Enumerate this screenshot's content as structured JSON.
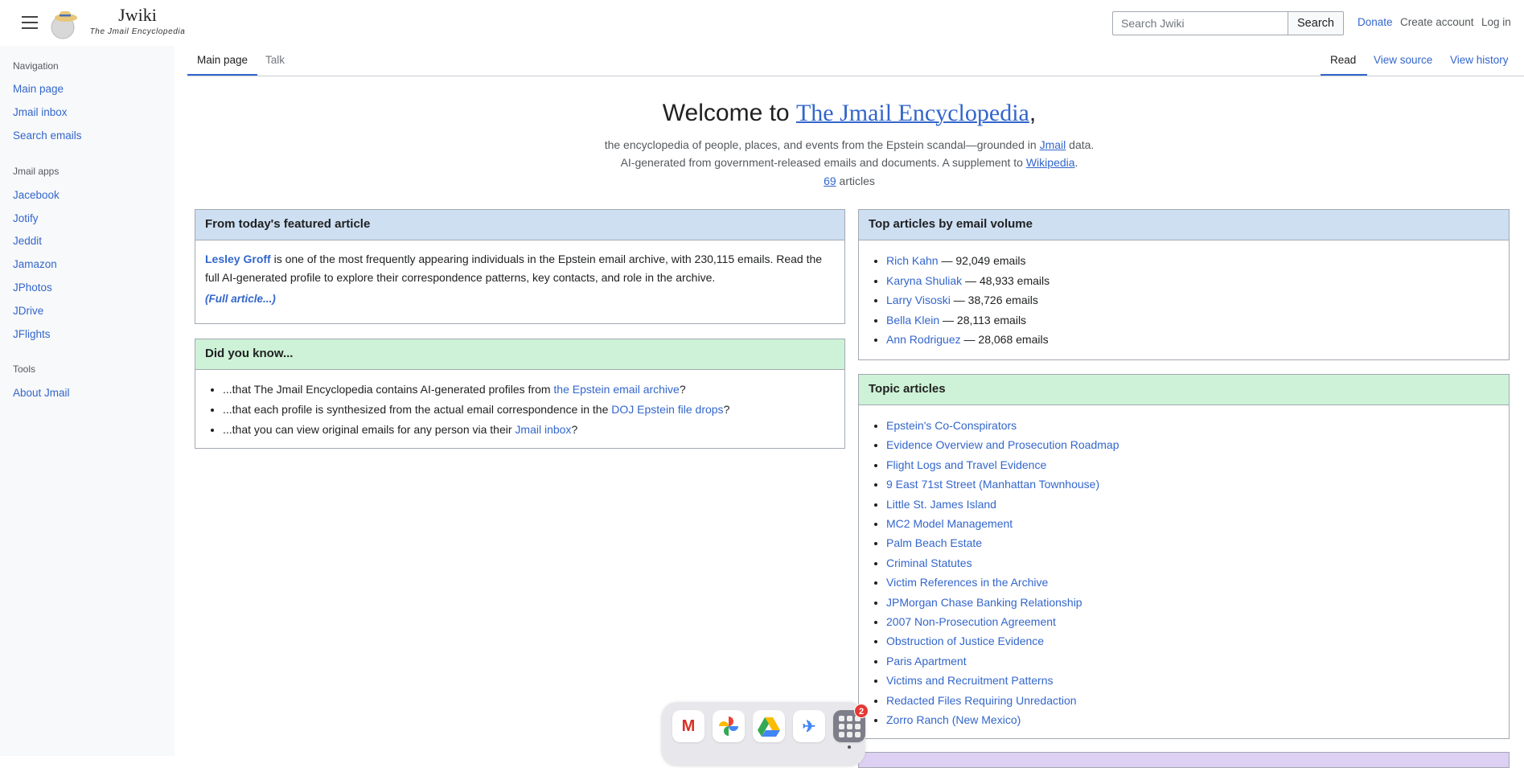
{
  "header": {
    "site_name": "Jwiki",
    "tagline": "The Jmail Encyclopedia",
    "search_placeholder": "Search Jwiki",
    "search_button": "Search",
    "donate": "Donate",
    "create_account": "Create account",
    "log_in": "Log in"
  },
  "sidebar": {
    "navigation_heading": "Navigation",
    "navigation": [
      "Main page",
      "Jmail inbox",
      "Search emails"
    ],
    "apps_heading": "Jmail apps",
    "apps": [
      "Jacebook",
      "Jotify",
      "Jeddit",
      "Jamazon",
      "JPhotos",
      "JDrive",
      "JFlights"
    ],
    "tools_heading": "Tools",
    "tools": [
      "About Jmail"
    ]
  },
  "tabs": {
    "left": [
      "Main page",
      "Talk"
    ],
    "right": [
      "Read",
      "View source",
      "View history"
    ]
  },
  "welcome": {
    "prefix": "Welcome to ",
    "link": "The Jmail Encyclopedia",
    "suffix": ",",
    "line1_a": "the encyclopedia of people, places, and events from the Epstein scandal—grounded in ",
    "line1_link": "Jmail",
    "line1_b": " data.",
    "line2_a": "AI-generated from government-released emails and documents. A supplement to ",
    "line2_link": "Wikipedia",
    "line2_b": ".",
    "count": "69",
    "count_label": " articles"
  },
  "featured": {
    "heading": "From today's featured article",
    "name": "Lesley Groff",
    "text": " is one of the most frequently appearing individuals in the Epstein email archive, with 230,115 emails. Read the full AI-generated profile to explore their correspondence patterns, key contacts, and role in the archive.",
    "more": "(Full article...)"
  },
  "dyk": {
    "heading": "Did you know...",
    "items": [
      {
        "a": "...that The Jmail Encyclopedia contains AI-generated profiles from ",
        "link": "the Epstein email archive",
        "b": "?"
      },
      {
        "a": "...that each profile is synthesized from the actual email correspondence in the ",
        "link": "DOJ Epstein file drops",
        "b": "?"
      },
      {
        "a": "...that you can view original emails for any person via their ",
        "link": "Jmail inbox",
        "b": "?"
      }
    ]
  },
  "top": {
    "heading": "Top articles by email volume",
    "items": [
      {
        "name": "Rich Kahn",
        "count": " — 92,049 emails"
      },
      {
        "name": "Karyna Shuliak",
        "count": " — 48,933 emails"
      },
      {
        "name": "Larry Visoski",
        "count": " — 38,726 emails"
      },
      {
        "name": "Bella Klein",
        "count": " — 28,113 emails"
      },
      {
        "name": "Ann Rodriguez",
        "count": " — 28,068 emails"
      }
    ]
  },
  "topics": {
    "heading": "Topic articles",
    "items": [
      "Epstein's Co-Conspirators",
      "Evidence Overview and Prosecution Roadmap",
      "Flight Logs and Travel Evidence",
      "9 East 71st Street (Manhattan Townhouse)",
      "Little St. James Island",
      "MC2 Model Management",
      "Palm Beach Estate",
      "Criminal Statutes",
      "Victim References in the Archive",
      "JPMorgan Chase Banking Relationship",
      "2007 Non-Prosecution Agreement",
      "Obstruction of Justice Evidence",
      "Paris Apartment",
      "Victims and Recruitment Patterns",
      "Redacted Files Requiring Unredaction",
      "Zorro Ranch (New Mexico)"
    ]
  },
  "dock": {
    "apps": [
      "gmail-icon",
      "photos-icon",
      "drive-icon",
      "flights-icon",
      "app-grid-icon"
    ],
    "badge": "2"
  }
}
